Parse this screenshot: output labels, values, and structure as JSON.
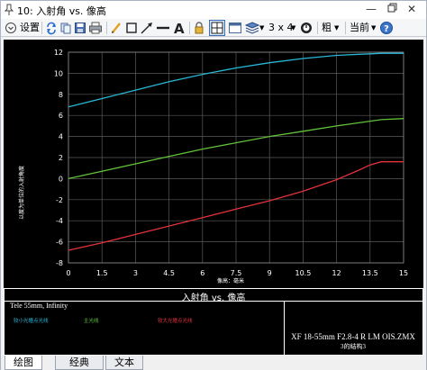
{
  "window": {
    "title": "10: 入射角 vs. 像高"
  },
  "toolbar": {
    "settings_label": "设置",
    "layout_label": "3 x 4",
    "weight_label": "粗",
    "current_label": "当前"
  },
  "chart_data": {
    "type": "line",
    "xlabel": "像高：毫米",
    "ylabel": "以度为单位的入射角度",
    "xlim": [
      0,
      15
    ],
    "ylim": [
      -8,
      12
    ],
    "x_ticks": [
      "0",
      "1.5",
      "3",
      "4.5",
      "6",
      "7.5",
      "9",
      "10.5",
      "12",
      "13.5",
      "15"
    ],
    "y_ticks": [
      "12",
      "10",
      "8",
      "6",
      "4",
      "2",
      "0",
      "-2",
      "-4",
      "-6",
      "-8"
    ],
    "grid": true,
    "x": [
      0,
      1.5,
      3,
      4.5,
      6,
      7.5,
      9,
      10.5,
      12,
      13,
      13.5,
      14,
      15
    ],
    "series": [
      {
        "name": "较小光瞳点光线",
        "color": "#2ab7d6",
        "values": [
          6.8,
          7.6,
          8.4,
          9.2,
          9.9,
          10.5,
          11.0,
          11.4,
          11.7,
          11.8,
          11.85,
          11.9,
          11.9
        ]
      },
      {
        "name": "主光线",
        "color": "#62c23a",
        "values": [
          0.0,
          0.7,
          1.4,
          2.1,
          2.8,
          3.4,
          4.0,
          4.5,
          5.0,
          5.3,
          5.45,
          5.6,
          5.7
        ]
      },
      {
        "name": "较大光瞳点光线",
        "color": "#e0333a",
        "values": [
          -6.8,
          -6.1,
          -5.3,
          -4.5,
          -3.7,
          -2.9,
          -2.1,
          -1.2,
          -0.1,
          0.8,
          1.3,
          1.6,
          1.6
        ]
      }
    ]
  },
  "info": {
    "title": "入射角 vs. 像高",
    "system": "Tele 55mm, Infinity",
    "file_name": "XF 18-55mm F2.8-4 R LM OIS.ZMX",
    "configuration": "3的结构3"
  },
  "tabs": [
    "绘图",
    "经典",
    "文本"
  ]
}
